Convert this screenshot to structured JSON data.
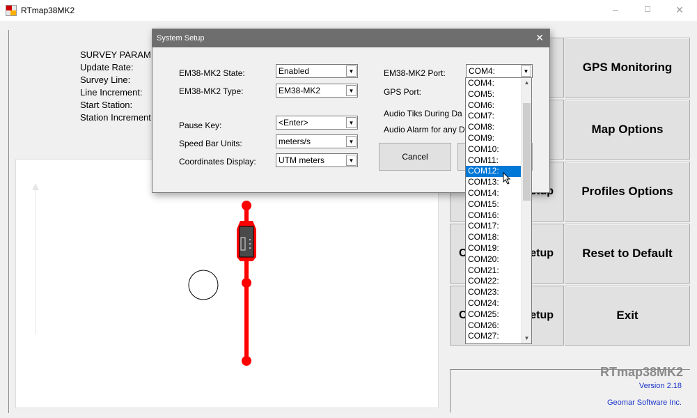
{
  "window": {
    "title": "RTmap38MK2"
  },
  "survey": {
    "heading": "SURVEY PARAMI",
    "rows": [
      "Update Rate:",
      "Survey Line:",
      "Line Increment:",
      "Start Station:",
      "Station Increment:"
    ]
  },
  "buttons": {
    "gps_monitoring": "GPS Monitoring",
    "map_options": "Map Options",
    "profiles_options": "Profiles Options",
    "reset_default": "Reset to Default",
    "exit": "Exit",
    "mid1": "etup",
    "mid2": "etup",
    "mid3": "etup",
    "mid1_prefix": "C",
    "mid3_prefix": "C"
  },
  "brand": {
    "name": "RTmap38MK2",
    "version": "Version 2.18",
    "company": "Geomar Software Inc."
  },
  "dialog": {
    "title": "System Setup",
    "state_label": "EM38-MK2 State:",
    "state_value": "Enabled",
    "type_label": "EM38-MK2 Type:",
    "type_value": "EM38-MK2",
    "pause_label": "Pause Key:",
    "pause_value": "<Enter>",
    "speed_label": "Speed Bar Units:",
    "speed_value": "meters/s",
    "coords_label": "Coordinates Display:",
    "coords_value": "UTM meters",
    "port_label": "EM38-MK2 Port:",
    "port_value": "COM4:",
    "gps_port_label": "GPS Port:",
    "audio_tiks_label": "Audio Tiks During Da",
    "audio_alarm_label": "Audio Alarm for any D",
    "cancel": "Cancel"
  },
  "port_options": [
    "COM4:",
    "COM5:",
    "COM6:",
    "COM7:",
    "COM8:",
    "COM9:",
    "COM10:",
    "COM11:",
    "COM12:",
    "COM13:",
    "COM14:",
    "COM15:",
    "COM16:",
    "COM17:",
    "COM18:",
    "COM19:",
    "COM20:",
    "COM21:",
    "COM22:",
    "COM23:",
    "COM24:",
    "COM25:",
    "COM26:",
    "COM27:"
  ],
  "port_selected": "COM12:",
  "colors": {
    "accent": "#0078d7",
    "survey_line": "#ff0000",
    "brand_blue": "#1a35c8"
  }
}
